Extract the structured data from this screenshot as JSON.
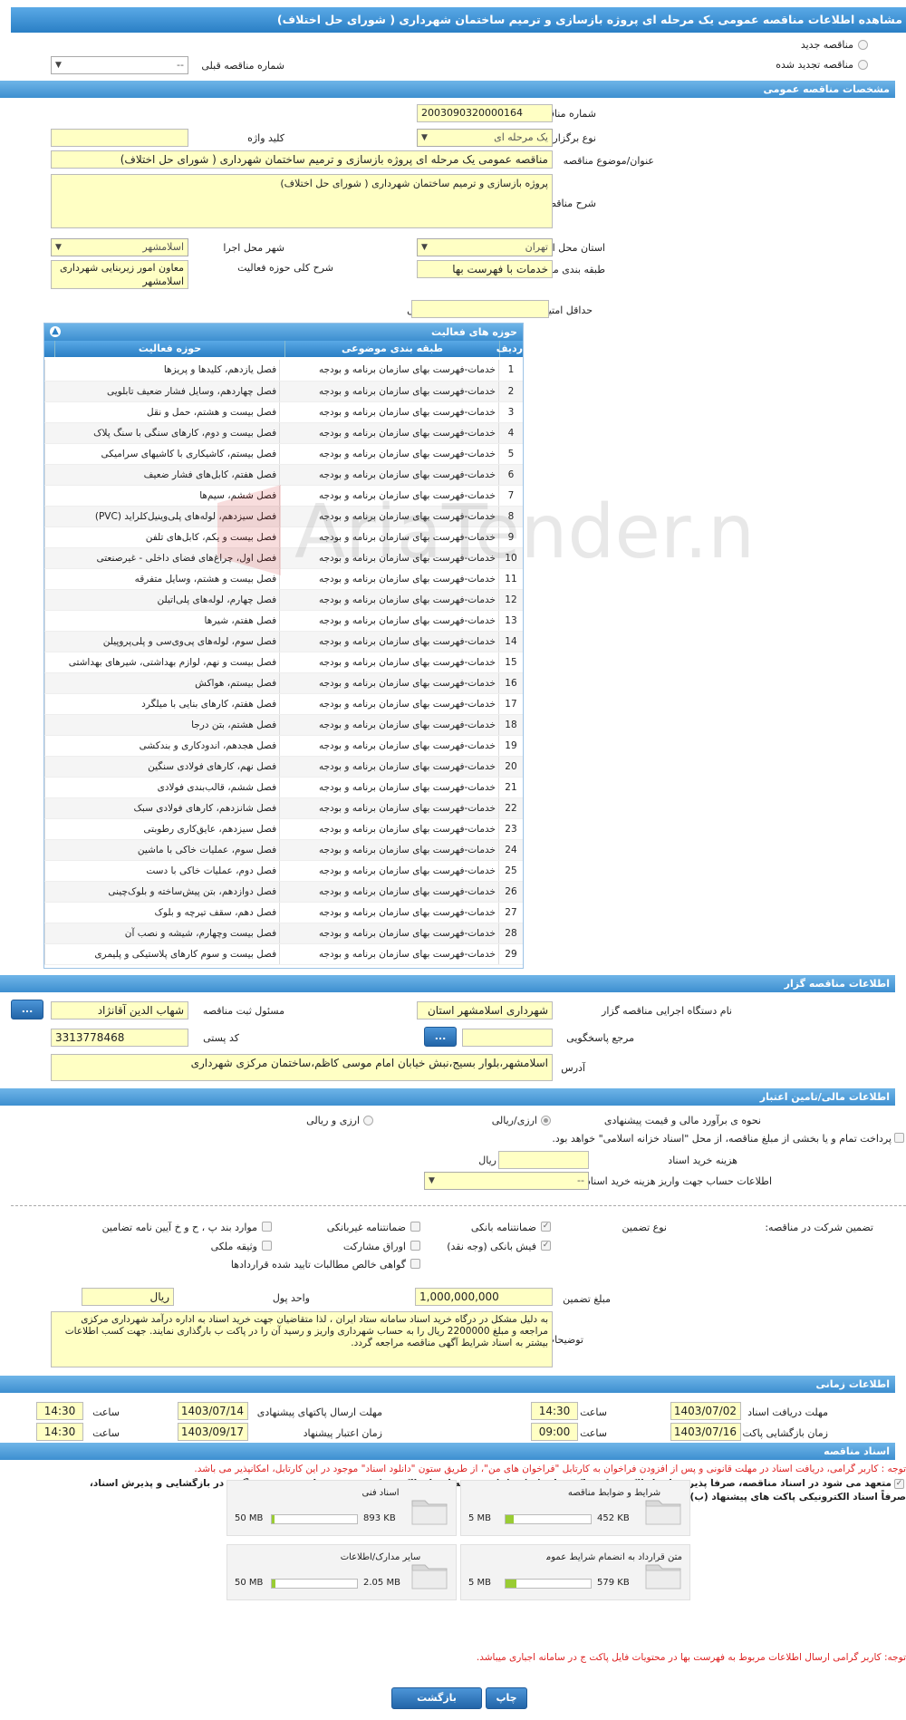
{
  "page": {
    "title": "مشاهده اطلاعات مناقصه عمومی یک مرحله ای پروژه بازسازی و ترمیم ساختمان شهرداری ( شورای حل اختلاف)"
  },
  "top": {
    "new_tender": "مناقصه جدید",
    "renewed_tender": "مناقصه تجدید شده",
    "prev_number_label": "شماره مناقصه قبلی",
    "prev_number_value": "--"
  },
  "general": {
    "header": "مشخصات مناقصه عمومی",
    "number_label": "شماره مناقصه",
    "number_value": "2003090320000164",
    "type_label": "نوع برگزاری",
    "type_value": "یک مرحله ای",
    "keyword_label": "کلید واژه",
    "keyword_value": "",
    "subject_label": "عنوان/موضوع مناقصه",
    "subject_value": "مناقصه عمومی یک مرحله ای پروژه بازسازی و ترمیم ساختمان شهرداری ( شورای حل اختلاف)",
    "desc_label": "شرح مناقصه",
    "desc_value": "پروژه بازسازی و ترمیم ساختمان شهرداری ( شورای حل اختلاف)",
    "province_label": "استان محل اجرا",
    "province_value": "تهران",
    "city_label": "شهر محل اجرا",
    "city_value": "اسلامشهر",
    "category_label": "طبقه بندی موضوعی",
    "category_value": "خدمات با فهرست بها",
    "scope_label": "شرح کلی حوزه فعالیت",
    "scope_value": "معاون امور زیربنایی شهرداری اسلامشهر",
    "min_score_label": "حداقل امتیاز قابل قبول ارزیابی فنی/بازرگانی",
    "min_score_value": ""
  },
  "activities": {
    "header": "حوزه های فعالیت",
    "columns": [
      "ردیف",
      "طبقه بندی موضوعی",
      "حوزه فعالیت"
    ],
    "rows": [
      [
        "1",
        "خدمات-فهرست بهای سازمان برنامه و بودجه",
        "فصل یازدهم، کلیدها و پریزها"
      ],
      [
        "2",
        "خدمات-فهرست بهای سازمان برنامه و بودجه",
        "فصل چهاردهم، وسایل فشار ضعیف تابلویی"
      ],
      [
        "3",
        "خدمات-فهرست بهای سازمان برنامه و بودجه",
        "فصل بیست و هشتم، حمل و نقل"
      ],
      [
        "4",
        "خدمات-فهرست بهای سازمان برنامه و بودجه",
        "فصل بیست و دوم، کارهای سنگی با سنگ پلاک"
      ],
      [
        "5",
        "خدمات-فهرست بهای سازمان برنامه و بودجه",
        "فصل بیستم، کاشیکاری با کاشیهای سرامیکی"
      ],
      [
        "6",
        "خدمات-فهرست بهای سازمان برنامه و بودجه",
        "فصل هفتم، کابل‌های فشار ضعیف"
      ],
      [
        "7",
        "خدمات-فهرست بهای سازمان برنامه و بودجه",
        "فصل ششم، سیم‌ها"
      ],
      [
        "8",
        "خدمات-فهرست بهای سازمان برنامه و بودجه",
        "فصل سیزدهم، لوله‌های پلی‌وینیل‌کلراید (PVC)"
      ],
      [
        "9",
        "خدمات-فهرست بهای سازمان برنامه و بودجه",
        "فصل بیست و یکم، کابل‌های تلفن"
      ],
      [
        "10",
        "خدمات-فهرست بهای سازمان برنامه و بودجه",
        "فصل اول، چراغ‌های فضای داخلی - غیرصنعتی"
      ],
      [
        "11",
        "خدمات-فهرست بهای سازمان برنامه و بودجه",
        "فصل بیست و هشتم، وسایل متفرقه"
      ],
      [
        "12",
        "خدمات-فهرست بهای سازمان برنامه و بودجه",
        "فصل چهارم، لوله‌های پلی‌اتیلن"
      ],
      [
        "13",
        "خدمات-فهرست بهای سازمان برنامه و بودجه",
        "فصل هفتم، شیرها"
      ],
      [
        "14",
        "خدمات-فهرست بهای سازمان برنامه و بودجه",
        "فصل سوم، لوله‌های پی‌وی‌سی و پلی‌پروپیلن"
      ],
      [
        "15",
        "خدمات-فهرست بهای سازمان برنامه و بودجه",
        "فصل بیست و نهم، لوازم بهداشتی، شیرهای بهداشتی"
      ],
      [
        "16",
        "خدمات-فهرست بهای سازمان برنامه و بودجه",
        "فصل بیستم، هواکش"
      ],
      [
        "17",
        "خدمات-فهرست بهای سازمان برنامه و بودجه",
        "فصل هفتم، کارهای بنایی با میلگرد"
      ],
      [
        "18",
        "خدمات-فهرست بهای سازمان برنامه و بودجه",
        "فصل هشتم، بتن درجا"
      ],
      [
        "19",
        "خدمات-فهرست بهای سازمان برنامه و بودجه",
        "فصل هجدهم، اندودکاری و بندکشی"
      ],
      [
        "20",
        "خدمات-فهرست بهای سازمان برنامه و بودجه",
        "فصل نهم، کارهای فولادی سنگین"
      ],
      [
        "21",
        "خدمات-فهرست بهای سازمان برنامه و بودجه",
        "فصل ششم، قالب‌بندی فولادی"
      ],
      [
        "22",
        "خدمات-فهرست بهای سازمان برنامه و بودجه",
        "فصل شانزدهم، کارهای فولادی سبک"
      ],
      [
        "23",
        "خدمات-فهرست بهای سازمان برنامه و بودجه",
        "فصل سیزدهم، عایق‌کاری رطوبتی"
      ],
      [
        "24",
        "خدمات-فهرست بهای سازمان برنامه و بودجه",
        "فصل سوم، عملیات خاکی با ماشین"
      ],
      [
        "25",
        "خدمات-فهرست بهای سازمان برنامه و بودجه",
        "فصل دوم، عملیات خاکی با دست"
      ],
      [
        "26",
        "خدمات-فهرست بهای سازمان برنامه و بودجه",
        "فصل دوازدهم، بتن پیش‌ساخته و بلوک‌چینی"
      ],
      [
        "27",
        "خدمات-فهرست بهای سازمان برنامه و بودجه",
        "فصل دهم، سقف تیرچه و بلوک"
      ],
      [
        "28",
        "خدمات-فهرست بهای سازمان برنامه و بودجه",
        "فصل بیست وچهارم، شیشه و نصب آن"
      ],
      [
        "29",
        "خدمات-فهرست بهای سازمان برنامه و بودجه",
        "فصل بیست و سوم کارهای پلاستیکی و پلیمری"
      ]
    ]
  },
  "organizer": {
    "header": "اطلاعات مناقصه گزار",
    "org_label": "نام دستگاه اجرایی مناقصه گزار",
    "org_value": "شهرداری اسلامشهر استان",
    "responsible_label": "مسئول ثبت مناقصه",
    "responsible_value": "شهاب الدین آقانژاد",
    "reference_label": "مرجع پاسخگویی",
    "reference_value": "",
    "postal_label": "کد پستی",
    "postal_value": "3313778468",
    "address_label": "آدرس",
    "address_value": "اسلامشهر،بلوار بسیج،نبش خیابان امام موسی کاظم،ساختمان مرکزی شهرداری",
    "dots": "..."
  },
  "finance": {
    "header": "اطلاعات مالی/تامین اعتبار",
    "estimate_label": "نحوه ی برآورد مالی و قیمت پیشنهادی",
    "opt_currency_rial": "ارزی/ریالی",
    "opt_rial": "ارزی و ریالی",
    "treasury_text": "پرداخت تمام و یا بخشی از مبلغ مناقصه، از محل \"اسناد خزانه اسلامی\" خواهد بود.",
    "doc_cost_label": "هزینه خرید اسناد",
    "doc_cost_unit": "ریال",
    "account_label": "اطلاعات حساب جهت واریز هزینه خرید اسناد",
    "account_value": "--",
    "guarantee_label": "تضمین شرکت در مناقصه:",
    "guarantee_type_label": "نوع تضمین",
    "g_bank": "ضمانتنامه بانکی",
    "g_nonbank": "ضمانتنامه غیربانکی",
    "g_articles": "موارد بند پ ، ح و خ آیین نامه تضامین",
    "g_cash": "فیش بانکی (وجه نقد)",
    "g_bonds": "اوراق مشارکت",
    "g_property": "وثیقه ملکی",
    "g_receivables": "گواهی خالص مطالبات تایید شده قراردادها",
    "amount_label": "مبلغ تضمین",
    "amount_value": "1,000,000,000",
    "currency_label": "واحد پول",
    "currency_value": "ریال",
    "notes_label": "توضیحات",
    "notes_value": "به دلیل مشکل در درگاه خرید اسناد سامانه ستاد ایران ، لذا متقاضیان جهت خرید اسناد به اداره درآمد شهرداری مرکزی مراجعه و مبلغ  2200000  ریال را به حساب شهرداری واریز و رسید آن را در پاکت ب بارگذاری نمایند. جهت کسب اطلاعات بیشتر به اسناد شرایط آگهی مناقصه مراجعه گردد."
  },
  "timing": {
    "header": "اطلاعات زمانی",
    "receive_label": "مهلت دریافت اسناد",
    "receive_date": "1403/07/02",
    "receive_time": "14:30",
    "send_label": "مهلت ارسال پاکتهای پیشنهادی",
    "send_date": "1403/07/14",
    "send_time": "14:30",
    "open_label": "زمان بازگشایی پاکت ها",
    "open_date": "1403/07/16",
    "open_time": "09:00",
    "validity_label": "زمان اعتبار پیشنهاد",
    "validity_date": "1403/09/17",
    "validity_time": "14:30",
    "time_label": "ساعت"
  },
  "docs": {
    "header": "اسناد مناقصه",
    "note1": "توجه : کاربر گرامی، دریافت اسناد در مهلت قانونی و پس از افزودن فراخوان به کارتابل \"فراخوان های من\"، از طریق ستون \"دانلود اسناد\" موجود در این کارتابل، امکانپذیر می باشد.",
    "commit_line1": "متعهد می شود در اسناد مناقصه، صرفاً پذیرش اسناد الکترونیکی پاکت های (ب) و (ج) مجهز به امضای الکترونیکی قید شده باشد. تعهد می گردد در بازگشایی و پذیرش اسناد،",
    "commit_line2": "صرفاً اسناد الکترونیکی پاکت های پیشنهاد (ب) و (ج) مجهز به امضای الکترونیکی صاحبان امضای مجاز مورد پذیرش واقع گردد.",
    "files": [
      {
        "name": "شرایط و ضوابط مناقصه",
        "size": "452 KB",
        "max": "5 MB",
        "fill": 0.09
      },
      {
        "name": "اسناد فنی",
        "size": "893 KB",
        "max": "50 MB",
        "fill": 0.02
      },
      {
        "name": "متن قرارداد به انضمام شرایط عمومی/خصوصی",
        "size": "579 KB",
        "max": "5 MB",
        "fill": 0.12
      },
      {
        "name": "سایر مدارک/اطلاعات",
        "size": "2.05 MB",
        "max": "50 MB",
        "fill": 0.04
      }
    ],
    "note2": "توجه: کاربر گرامی ارسال اطلاعات مربوط به فهرست بها در محتویات فایل پاکت ج در سامانه اجباری میباشد."
  },
  "buttons": {
    "print": "چاپ",
    "back": "بازگشت"
  },
  "watermark": "AriaTender.neT"
}
